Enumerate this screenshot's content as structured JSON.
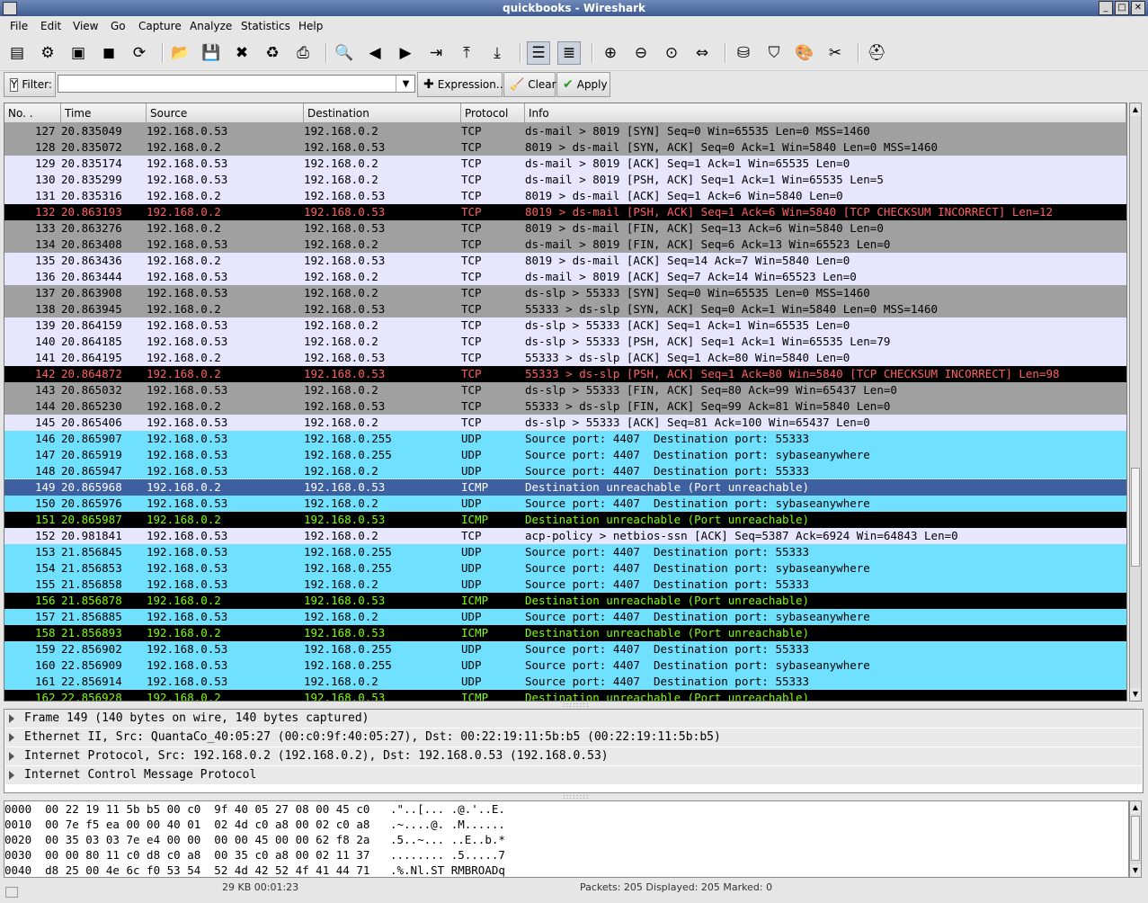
{
  "window": {
    "title": "quickbooks - Wireshark"
  },
  "menu": [
    "File",
    "Edit",
    "View",
    "Go",
    "Capture",
    "Analyze",
    "Statistics",
    "Help"
  ],
  "toolbar": {
    "buttons": [
      {
        "name": "interfaces-icon",
        "glyph": "▤"
      },
      {
        "name": "capture-options-icon",
        "glyph": "⚙"
      },
      {
        "name": "start-capture-icon",
        "glyph": "▣"
      },
      {
        "name": "stop-capture-icon",
        "glyph": "◼"
      },
      {
        "name": "restart-capture-icon",
        "glyph": "⟳"
      },
      {
        "name": "open-file-icon",
        "glyph": "📂"
      },
      {
        "name": "save-file-icon",
        "glyph": "💾"
      },
      {
        "name": "close-file-icon",
        "glyph": "✖"
      },
      {
        "name": "reload-icon",
        "glyph": "♻"
      },
      {
        "name": "print-icon",
        "glyph": "⎙"
      },
      {
        "name": "find-packet-icon",
        "glyph": "🔍"
      },
      {
        "name": "go-back-icon",
        "glyph": "◀"
      },
      {
        "name": "go-forward-icon",
        "glyph": "▶"
      },
      {
        "name": "go-to-packet-icon",
        "glyph": "⇥"
      },
      {
        "name": "first-packet-icon",
        "glyph": "⤒"
      },
      {
        "name": "last-packet-icon",
        "glyph": "⤓"
      },
      {
        "name": "colorize-icon",
        "glyph": "☰"
      },
      {
        "name": "auto-scroll-icon",
        "glyph": "≣"
      },
      {
        "name": "zoom-in-icon",
        "glyph": "⊕"
      },
      {
        "name": "zoom-out-icon",
        "glyph": "⊖"
      },
      {
        "name": "normal-size-icon",
        "glyph": "⊙"
      },
      {
        "name": "resize-columns-icon",
        "glyph": "⇔"
      },
      {
        "name": "capture-filters-icon",
        "glyph": "⛁"
      },
      {
        "name": "display-filters-icon",
        "glyph": "⛉"
      },
      {
        "name": "coloring-rules-icon",
        "glyph": "🎨"
      },
      {
        "name": "preferences-icon",
        "glyph": "✂"
      },
      {
        "name": "help-icon",
        "glyph": "⛑"
      }
    ]
  },
  "filter": {
    "label": "Filter:",
    "value": "",
    "expression_label": "Expression...",
    "clear_label": "Clear",
    "apply_label": "Apply"
  },
  "columns": [
    "No. .",
    "Time",
    "Source",
    "Destination",
    "Protocol",
    "Info"
  ],
  "colors": {
    "tcp_gray": "#a0a0a0",
    "tcp_lavender": "#e7e6ff",
    "udp_cyan": "#70e0ff",
    "icmp_black": "#000000",
    "error_text": "#ff5f5f",
    "icmp_text": "#7fff00",
    "selected": "#3e5fa0"
  },
  "packets": [
    {
      "no": "127",
      "time": "20.835049",
      "src": "192.168.0.53",
      "dst": "192.168.0.2",
      "proto": "TCP",
      "info": "ds-mail > 8019 [SYN] Seq=0 Win=65535 Len=0 MSS=1460",
      "style": "gray"
    },
    {
      "no": "128",
      "time": "20.835072",
      "src": "192.168.0.2",
      "dst": "192.168.0.53",
      "proto": "TCP",
      "info": "8019 > ds-mail [SYN, ACK] Seq=0 Ack=1 Win=5840 Len=0 MSS=1460",
      "style": "gray"
    },
    {
      "no": "129",
      "time": "20.835174",
      "src": "192.168.0.53",
      "dst": "192.168.0.2",
      "proto": "TCP",
      "info": "ds-mail > 8019 [ACK] Seq=1 Ack=1 Win=65535 Len=0",
      "style": "lav"
    },
    {
      "no": "130",
      "time": "20.835299",
      "src": "192.168.0.53",
      "dst": "192.168.0.2",
      "proto": "TCP",
      "info": "ds-mail > 8019 [PSH, ACK] Seq=1 Ack=1 Win=65535 Len=5",
      "style": "lav"
    },
    {
      "no": "131",
      "time": "20.835316",
      "src": "192.168.0.2",
      "dst": "192.168.0.53",
      "proto": "TCP",
      "info": "8019 > ds-mail [ACK] Seq=1 Ack=6 Win=5840 Len=0",
      "style": "lav"
    },
    {
      "no": "132",
      "time": "20.863193",
      "src": "192.168.0.2",
      "dst": "192.168.0.53",
      "proto": "TCP",
      "info": "8019 > ds-mail [PSH, ACK] Seq=1 Ack=6 Win=5840 [TCP CHECKSUM INCORRECT] Len=12",
      "style": "bad"
    },
    {
      "no": "133",
      "time": "20.863276",
      "src": "192.168.0.2",
      "dst": "192.168.0.53",
      "proto": "TCP",
      "info": "8019 > ds-mail [FIN, ACK] Seq=13 Ack=6 Win=5840 Len=0",
      "style": "gray"
    },
    {
      "no": "134",
      "time": "20.863408",
      "src": "192.168.0.53",
      "dst": "192.168.0.2",
      "proto": "TCP",
      "info": "ds-mail > 8019 [FIN, ACK] Seq=6 Ack=13 Win=65523 Len=0",
      "style": "gray"
    },
    {
      "no": "135",
      "time": "20.863436",
      "src": "192.168.0.2",
      "dst": "192.168.0.53",
      "proto": "TCP",
      "info": "8019 > ds-mail [ACK] Seq=14 Ack=7 Win=5840 Len=0",
      "style": "lav"
    },
    {
      "no": "136",
      "time": "20.863444",
      "src": "192.168.0.53",
      "dst": "192.168.0.2",
      "proto": "TCP",
      "info": "ds-mail > 8019 [ACK] Seq=7 Ack=14 Win=65523 Len=0",
      "style": "lav"
    },
    {
      "no": "137",
      "time": "20.863908",
      "src": "192.168.0.53",
      "dst": "192.168.0.2",
      "proto": "TCP",
      "info": "ds-slp > 55333 [SYN] Seq=0 Win=65535 Len=0 MSS=1460",
      "style": "gray"
    },
    {
      "no": "138",
      "time": "20.863945",
      "src": "192.168.0.2",
      "dst": "192.168.0.53",
      "proto": "TCP",
      "info": "55333 > ds-slp [SYN, ACK] Seq=0 Ack=1 Win=5840 Len=0 MSS=1460",
      "style": "gray"
    },
    {
      "no": "139",
      "time": "20.864159",
      "src": "192.168.0.53",
      "dst": "192.168.0.2",
      "proto": "TCP",
      "info": "ds-slp > 55333 [ACK] Seq=1 Ack=1 Win=65535 Len=0",
      "style": "lav"
    },
    {
      "no": "140",
      "time": "20.864185",
      "src": "192.168.0.53",
      "dst": "192.168.0.2",
      "proto": "TCP",
      "info": "ds-slp > 55333 [PSH, ACK] Seq=1 Ack=1 Win=65535 Len=79",
      "style": "lav"
    },
    {
      "no": "141",
      "time": "20.864195",
      "src": "192.168.0.2",
      "dst": "192.168.0.53",
      "proto": "TCP",
      "info": "55333 > ds-slp [ACK] Seq=1 Ack=80 Win=5840 Len=0",
      "style": "lav"
    },
    {
      "no": "142",
      "time": "20.864872",
      "src": "192.168.0.2",
      "dst": "192.168.0.53",
      "proto": "TCP",
      "info": "55333 > ds-slp [PSH, ACK] Seq=1 Ack=80 Win=5840 [TCP CHECKSUM INCORRECT] Len=98",
      "style": "bad"
    },
    {
      "no": "143",
      "time": "20.865032",
      "src": "192.168.0.53",
      "dst": "192.168.0.2",
      "proto": "TCP",
      "info": "ds-slp > 55333 [FIN, ACK] Seq=80 Ack=99 Win=65437 Len=0",
      "style": "gray"
    },
    {
      "no": "144",
      "time": "20.865230",
      "src": "192.168.0.2",
      "dst": "192.168.0.53",
      "proto": "TCP",
      "info": "55333 > ds-slp [FIN, ACK] Seq=99 Ack=81 Win=5840 Len=0",
      "style": "gray"
    },
    {
      "no": "145",
      "time": "20.865406",
      "src": "192.168.0.53",
      "dst": "192.168.0.2",
      "proto": "TCP",
      "info": "ds-slp > 55333 [ACK] Seq=81 Ack=100 Win=65437 Len=0",
      "style": "lav"
    },
    {
      "no": "146",
      "time": "20.865907",
      "src": "192.168.0.53",
      "dst": "192.168.0.255",
      "proto": "UDP",
      "info": "Source port: 4407  Destination port: 55333",
      "style": "udp"
    },
    {
      "no": "147",
      "time": "20.865919",
      "src": "192.168.0.53",
      "dst": "192.168.0.255",
      "proto": "UDP",
      "info": "Source port: 4407  Destination port: sybaseanywhere",
      "style": "udp"
    },
    {
      "no": "148",
      "time": "20.865947",
      "src": "192.168.0.53",
      "dst": "192.168.0.2",
      "proto": "UDP",
      "info": "Source port: 4407  Destination port: 55333",
      "style": "udp"
    },
    {
      "no": "149",
      "time": "20.865968",
      "src": "192.168.0.2",
      "dst": "192.168.0.53",
      "proto": "ICMP",
      "info": "Destination unreachable (Port unreachable)",
      "style": "sel"
    },
    {
      "no": "150",
      "time": "20.865976",
      "src": "192.168.0.53",
      "dst": "192.168.0.2",
      "proto": "UDP",
      "info": "Source port: 4407  Destination port: sybaseanywhere",
      "style": "udp"
    },
    {
      "no": "151",
      "time": "20.865987",
      "src": "192.168.0.2",
      "dst": "192.168.0.53",
      "proto": "ICMP",
      "info": "Destination unreachable (Port unreachable)",
      "style": "icmp"
    },
    {
      "no": "152",
      "time": "20.981841",
      "src": "192.168.0.53",
      "dst": "192.168.0.2",
      "proto": "TCP",
      "info": "acp-policy > netbios-ssn [ACK] Seq=5387 Ack=6924 Win=64843 Len=0",
      "style": "lav"
    },
    {
      "no": "153",
      "time": "21.856845",
      "src": "192.168.0.53",
      "dst": "192.168.0.255",
      "proto": "UDP",
      "info": "Source port: 4407  Destination port: 55333",
      "style": "udp"
    },
    {
      "no": "154",
      "time": "21.856853",
      "src": "192.168.0.53",
      "dst": "192.168.0.255",
      "proto": "UDP",
      "info": "Source port: 4407  Destination port: sybaseanywhere",
      "style": "udp"
    },
    {
      "no": "155",
      "time": "21.856858",
      "src": "192.168.0.53",
      "dst": "192.168.0.2",
      "proto": "UDP",
      "info": "Source port: 4407  Destination port: 55333",
      "style": "udp"
    },
    {
      "no": "156",
      "time": "21.856878",
      "src": "192.168.0.2",
      "dst": "192.168.0.53",
      "proto": "ICMP",
      "info": "Destination unreachable (Port unreachable)",
      "style": "icmp"
    },
    {
      "no": "157",
      "time": "21.856885",
      "src": "192.168.0.53",
      "dst": "192.168.0.2",
      "proto": "UDP",
      "info": "Source port: 4407  Destination port: sybaseanywhere",
      "style": "udp"
    },
    {
      "no": "158",
      "time": "21.856893",
      "src": "192.168.0.2",
      "dst": "192.168.0.53",
      "proto": "ICMP",
      "info": "Destination unreachable (Port unreachable)",
      "style": "icmp"
    },
    {
      "no": "159",
      "time": "22.856902",
      "src": "192.168.0.53",
      "dst": "192.168.0.255",
      "proto": "UDP",
      "info": "Source port: 4407  Destination port: 55333",
      "style": "udp"
    },
    {
      "no": "160",
      "time": "22.856909",
      "src": "192.168.0.53",
      "dst": "192.168.0.255",
      "proto": "UDP",
      "info": "Source port: 4407  Destination port: sybaseanywhere",
      "style": "udp"
    },
    {
      "no": "161",
      "time": "22.856914",
      "src": "192.168.0.53",
      "dst": "192.168.0.2",
      "proto": "UDP",
      "info": "Source port: 4407  Destination port: 55333",
      "style": "udp"
    },
    {
      "no": "162",
      "time": "22.856928",
      "src": "192.168.0.2",
      "dst": "192.168.0.53",
      "proto": "ICMP",
      "info": "Destination unreachable (Port unreachable)",
      "style": "icmp"
    }
  ],
  "details": [
    "Frame 149 (140 bytes on wire, 140 bytes captured)",
    "Ethernet II, Src: QuantaCo_40:05:27 (00:c0:9f:40:05:27), Dst: 00:22:19:11:5b:b5 (00:22:19:11:5b:b5)",
    "Internet Protocol, Src: 192.168.0.2 (192.168.0.2), Dst: 192.168.0.53 (192.168.0.53)",
    "Internet Control Message Protocol"
  ],
  "hex": [
    "0000  00 22 19 11 5b b5 00 c0  9f 40 05 27 08 00 45 c0   .\"..[... .@.'..E.",
    "0010  00 7e f5 ea 00 00 40 01  02 4d c0 a8 00 02 c0 a8   .~....@. .M......",
    "0020  00 35 03 03 7e e4 00 00  00 00 45 00 00 62 f8 2a   .5..~... ..E..b.*",
    "0030  00 00 80 11 c0 d8 c0 a8  00 35 c0 a8 00 02 11 37   ........ .5.....7",
    "0040  d8 25 00 4e 6c f0 53 54  52 4d 42 52 4f 41 44 71   .%.Nl.ST RMBROADq"
  ],
  "status": {
    "file": "29 KB 00:01:23",
    "packets": "Packets: 205 Displayed: 205 Marked: 0"
  }
}
